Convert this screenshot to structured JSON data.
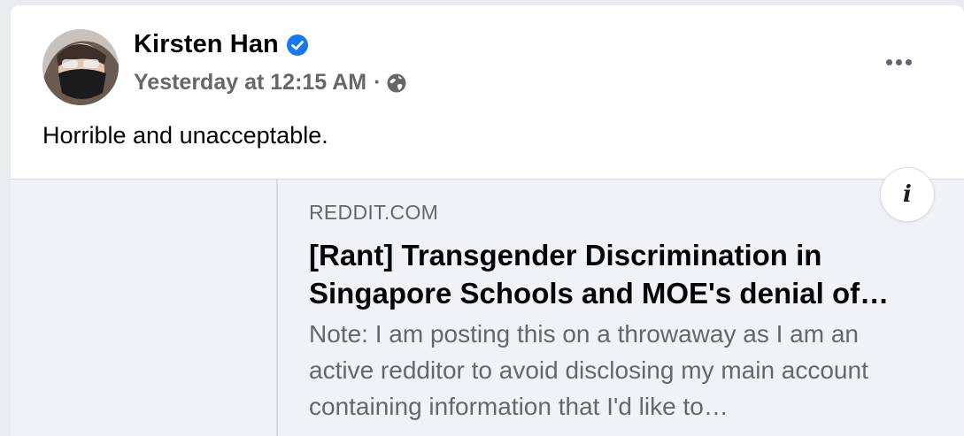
{
  "post": {
    "author": "Kirsten Han",
    "timestamp": "Yesterday at 12:15 AM",
    "separator": "·",
    "text": "Horrible and unacceptable.",
    "icons": {
      "verified": "verified-badge-icon",
      "privacy": "globe-icon",
      "more": "more-options-icon",
      "info": "info-icon"
    }
  },
  "link_preview": {
    "domain": "REDDIT.COM",
    "title": "[Rant] Transgender Discrimination in Singapore Schools and MOE's denial of…",
    "description": "Note: I am posting this on a throwaway as I am an active redditor to avoid disclosing my main account containing information that I'd like to…",
    "info_glyph": "i"
  },
  "colors": {
    "verified_blue": "#1877f2",
    "secondary_text": "#65676b",
    "preview_background": "#f0f2f5"
  }
}
